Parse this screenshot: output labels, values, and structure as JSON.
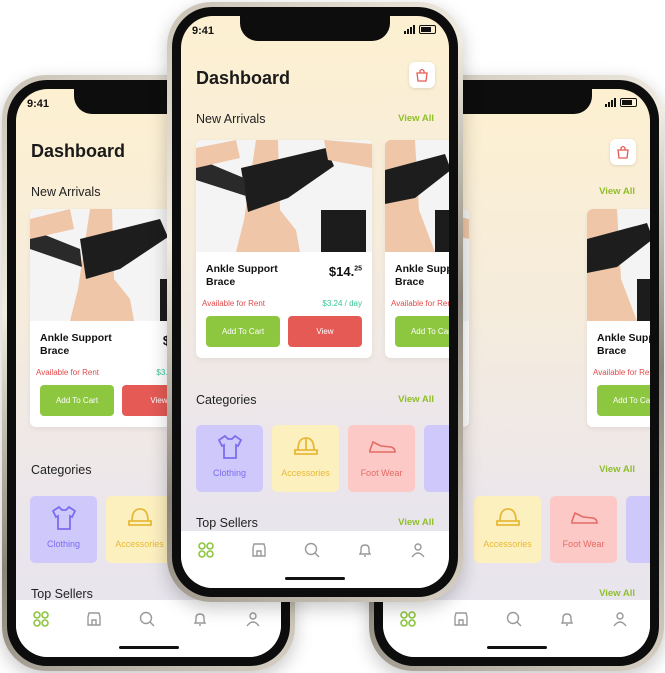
{
  "status": {
    "time": "9:41"
  },
  "header": {
    "title": "Dashboard"
  },
  "sections": {
    "new_arrivals": "New Arrivals",
    "categories": "Categories",
    "top_sellers": "Top Sellers",
    "view_all": "View All"
  },
  "product": {
    "name_line1": "Ankle Support",
    "name_line2": "Brace",
    "price_main": "$14.",
    "price_cents": "25",
    "rent_status": "Available for Rent",
    "rent_price": "$3.24 / day",
    "add_to_cart": "Add To Cart",
    "view": "View"
  },
  "categories": [
    {
      "label": "Clothing",
      "icon": "shirt-icon",
      "bg": "#cfc9fb",
      "color": "#7b6cf0"
    },
    {
      "label": "Accessories",
      "icon": "hat-icon",
      "bg": "#fdf0bf",
      "color": "#e7b93a"
    },
    {
      "label": "Foot Wear",
      "icon": "shoe-icon",
      "bg": "#fcc9c7",
      "color": "#e36b65"
    },
    {
      "label": "",
      "icon": "category-icon",
      "bg": "#cfc9fb",
      "color": "#7b6cf0"
    }
  ],
  "tabs": [
    "home-icon",
    "store-icon",
    "search-icon",
    "bell-icon",
    "profile-icon"
  ],
  "colors": {
    "accent": "#8dc63f",
    "danger": "#e55a55",
    "green_text": "#33c59a"
  }
}
